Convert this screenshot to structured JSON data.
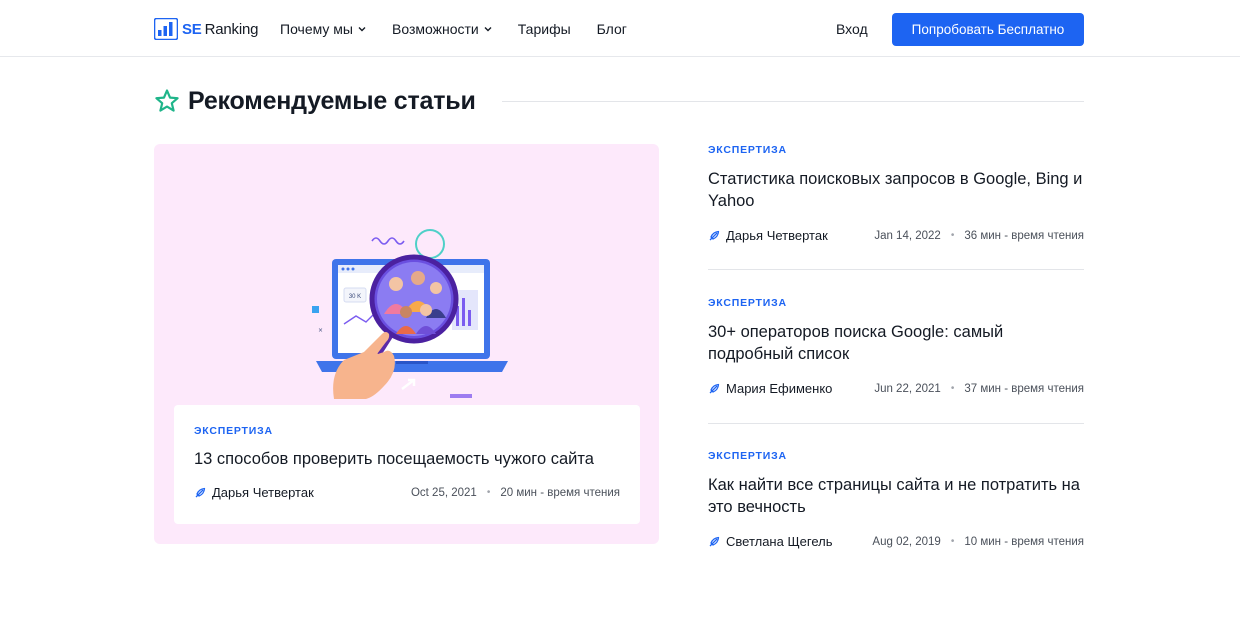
{
  "header": {
    "logo_se": "SE",
    "logo_rank": "Ranking",
    "nav": [
      {
        "label": "Почему мы",
        "has_dropdown": true
      },
      {
        "label": "Возможности",
        "has_dropdown": true
      },
      {
        "label": "Тарифы",
        "has_dropdown": false
      },
      {
        "label": "Блог",
        "has_dropdown": false
      }
    ],
    "login_label": "Вход",
    "cta_label": "Попробовать Бесплатно"
  },
  "section": {
    "title": "Рекомендуемые статьи",
    "icon": "star-icon"
  },
  "featured": {
    "category": "ЭКСПЕРТИЗА",
    "title": "13 способов проверить посещаемость чужого сайта",
    "author": "Дарья Четвертак",
    "date": "Oct 25, 2021",
    "read_time": "20 мин - время чтения",
    "illustration_label": "30 K"
  },
  "articles": [
    {
      "category": "ЭКСПЕРТИЗА",
      "title": "Статистика поисковых запросов в Google, Bing и Yahoo",
      "author": "Дарья Четвертак",
      "date": "Jan 14, 2022",
      "read_time": "36 мин - время чтения"
    },
    {
      "category": "ЭКСПЕРТИЗА",
      "title": "30+ операторов поиска Google: самый подробный список",
      "author": "Мария Ефименко",
      "date": "Jun 22, 2021",
      "read_time": "37 мин - время чтения"
    },
    {
      "category": "ЭКСПЕРТИЗА",
      "title": "Как найти все страницы сайта и не потратить на это вечность",
      "author": "Светлана Щегель",
      "date": "Aug 02, 2019",
      "read_time": "10 мин - время чтения"
    }
  ],
  "colors": {
    "accent": "#1d64f2",
    "star": "#1fb58a",
    "card_bg": "#fde9fb",
    "text": "#141a24"
  }
}
